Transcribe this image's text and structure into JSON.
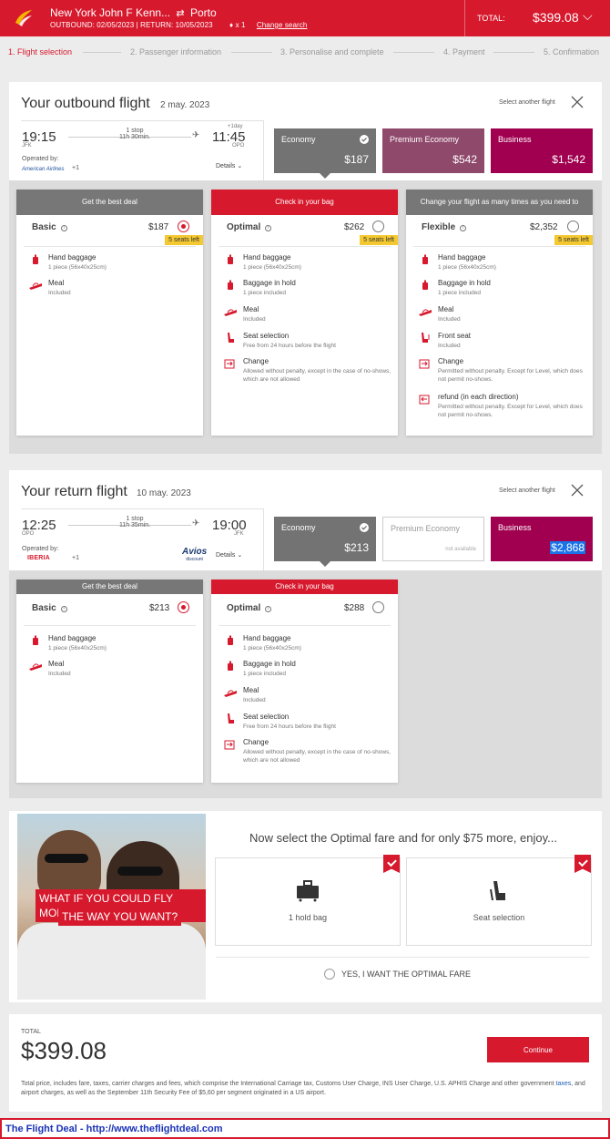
{
  "header": {
    "origin": "New York John F Kenn...",
    "destination": "Porto",
    "outbound_label": "OUTBOUND: 02/05/2023",
    "return_label": "RETURN: 10/05/2023",
    "passengers": "x 1",
    "change_search": "Change search",
    "total_label": "TOTAL:",
    "total_amount": "$399.08",
    "brand_color": "#d7192d"
  },
  "steps": [
    "1. Flight selection",
    "2. Passenger information",
    "3. Personalise and complete",
    "4. Payment",
    "5. Confirmation"
  ],
  "outbound": {
    "title": "Your outbound flight",
    "date": "2 may. 2023",
    "select_another": "Select another flight",
    "dep_time": "19:15",
    "dep_code": "JFK",
    "stops": "1 stop",
    "duration": "11h 30min.",
    "plus_day": "+1day",
    "arr_time": "11:45",
    "arr_code": "OPO",
    "operated_by": "Operated by:",
    "airline": "American Airlines",
    "plus_airlines": "+1",
    "details": "Details",
    "cabins": [
      {
        "name": "Economy",
        "price": "$187",
        "selected": true
      },
      {
        "name": "Premium Economy",
        "price": "$542"
      },
      {
        "name": "Business",
        "price": "$1,542"
      }
    ],
    "fares": [
      {
        "header": "Get the best deal",
        "name": "Basic",
        "price": "$187",
        "selected": true,
        "seats": "5 seats left",
        "features": [
          {
            "icon": "hand-baggage-icon",
            "title": "Hand baggage",
            "desc": "1 piece (56x40x25cm)"
          },
          {
            "icon": "meal-icon",
            "title": "Meal",
            "desc": "Included"
          }
        ]
      },
      {
        "header": "Check in your bag",
        "name": "Optimal",
        "price": "$262",
        "selected": false,
        "seats": "5 seats left",
        "features": [
          {
            "icon": "hand-baggage-icon",
            "title": "Hand baggage",
            "desc": "1 piece (56x40x25cm)"
          },
          {
            "icon": "hold-baggage-icon",
            "title": "Baggage in hold",
            "desc": "1 piece included"
          },
          {
            "icon": "meal-icon",
            "title": "Meal",
            "desc": "Included"
          },
          {
            "icon": "seat-icon",
            "title": "Seat selection",
            "desc": "Free from 24 hours before the flight"
          },
          {
            "icon": "change-icon",
            "title": "Change",
            "desc": "Allowed without penalty, except in the case of no-shows, which are not allowed"
          }
        ]
      },
      {
        "header": "Change your flight as many times as you need to",
        "name": "Flexible",
        "price": "$2,352",
        "selected": false,
        "seats": "5 seats left",
        "features": [
          {
            "icon": "hand-baggage-icon",
            "title": "Hand baggage",
            "desc": "1 piece (56x40x25cm)"
          },
          {
            "icon": "hold-baggage-icon",
            "title": "Baggage in hold",
            "desc": "1 piece included"
          },
          {
            "icon": "meal-icon",
            "title": "Meal",
            "desc": "Included"
          },
          {
            "icon": "front-seat-icon",
            "title": "Front seat",
            "desc": "Included"
          },
          {
            "icon": "change-icon",
            "title": "Change",
            "desc": "Permitted without penalty. Except for Level, which does not permit no-shows."
          },
          {
            "icon": "refund-icon",
            "title": "refund (in each direction)",
            "desc": "Permitted without penalty. Except for Level, which does not permit no-shows."
          }
        ]
      }
    ]
  },
  "return": {
    "title": "Your return flight",
    "date": "10 may. 2023",
    "select_another": "Select another flight",
    "dep_time": "12:25",
    "dep_code": "OPO",
    "stops": "1 stop",
    "duration": "11h 35min.",
    "arr_time": "19:00",
    "arr_code": "JFK",
    "operated_by": "Operated by:",
    "airline": "IBERIA",
    "plus_airlines": "+1",
    "avios": "Avios",
    "avios_sub": "discount",
    "details": "Details",
    "cabins": [
      {
        "name": "Economy",
        "price": "$213",
        "selected": true
      },
      {
        "name": "Premium Economy",
        "price": "not available"
      },
      {
        "name": "Business",
        "price": "$2,868"
      }
    ],
    "fares": [
      {
        "header": "Get the best deal",
        "name": "Basic",
        "price": "$213",
        "selected": true,
        "features": [
          {
            "icon": "hand-baggage-icon",
            "title": "Hand baggage",
            "desc": "1 piece (56x40x25cm)"
          },
          {
            "icon": "meal-icon",
            "title": "Meal",
            "desc": "Included"
          }
        ]
      },
      {
        "header": "Check in your bag",
        "name": "Optimal",
        "price": "$288",
        "selected": false,
        "features": [
          {
            "icon": "hand-baggage-icon",
            "title": "Hand baggage",
            "desc": "1 piece (56x40x25cm)"
          },
          {
            "icon": "hold-baggage-icon",
            "title": "Baggage in hold",
            "desc": "1 piece included"
          },
          {
            "icon": "meal-icon",
            "title": "Meal",
            "desc": "Included"
          },
          {
            "icon": "seat-icon",
            "title": "Seat selection",
            "desc": "Free from 24 hours before the flight"
          },
          {
            "icon": "change-icon",
            "title": "Change",
            "desc": "Allowed without penalty, except in the case of no-shows, which are not allowed"
          }
        ]
      }
    ]
  },
  "promo": {
    "caption_line1": "WHAT IF YOU COULD FLY MORE",
    "caption_line2": "THE WAY YOU WANT?",
    "title": "Now select the Optimal fare and for only $75 more, enjoy...",
    "option1": "1 hold bag",
    "option2": "Seat selection",
    "cta": "YES, I WANT THE OPTIMAL FARE"
  },
  "total": {
    "label": "TOTAL",
    "amount": "$399.08",
    "continue": "Continue",
    "note_part1": "Total price, includes fare, taxes, carrier charges and fees, which comprise the International Carriage tax, Customs User Charge, INS User Charge, U.S. APHIS Charge and other government ",
    "note_link": "taxes",
    "note_part2": ", and airport charges, as well as the September 11th Security Fee of $5,60 per segment originated in a US airport."
  },
  "footer": "The Flight Deal - http://www.theflightdeal.com"
}
